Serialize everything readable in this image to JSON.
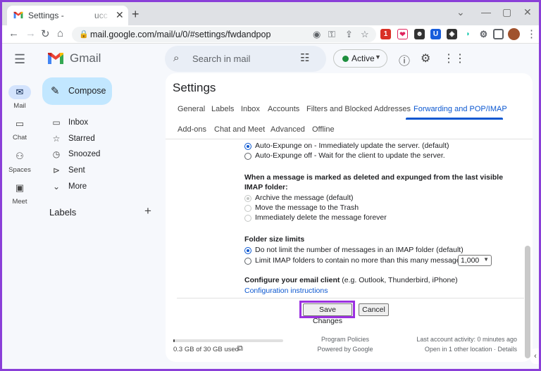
{
  "browser": {
    "tab_title": "Settings - ",
    "tab_title_tail": "ucc",
    "url": "mail.google.com/mail/u/0/#settings/fwdandpop",
    "extension_badge": "1"
  },
  "gmail": {
    "product": "Gmail",
    "search_placeholder": "Search in mail",
    "status": "Active",
    "status_color": "#1e8e3e",
    "accent_color": "#0b57d0",
    "compose_color": "#c2e7ff",
    "highlight_color": "#9b30e0"
  },
  "rail": {
    "mail": "Mail",
    "chat": "Chat",
    "spaces": "Spaces",
    "meet": "Meet"
  },
  "sidebar": {
    "compose": "Compose",
    "items": [
      {
        "label": "Inbox",
        "icon": "inbox-icon"
      },
      {
        "label": "Starred",
        "icon": "star-icon"
      },
      {
        "label": "Snoozed",
        "icon": "clock-icon"
      },
      {
        "label": "Sent",
        "icon": "send-icon"
      },
      {
        "label": "More",
        "icon": "chevron-down-icon"
      }
    ],
    "labels_heading": "Labels"
  },
  "settings": {
    "title": "Settings",
    "tabs": [
      "General",
      "Labels",
      "Inbox",
      "Accounts",
      "Filters and Blocked Addresses",
      "Forwarding and POP/IMAP",
      "Add-ons",
      "Chat and Meet",
      "Advanced",
      "Offline"
    ],
    "active_tab": "Forwarding and POP/IMAP",
    "expunge": {
      "on": "Auto-Expunge on - Immediately update the server. (default)",
      "off": "Auto-Expunge off - Wait for the client to update the server.",
      "selected": "on"
    },
    "deleted": {
      "title_line1": "When a message is marked as deleted and expunged from the last visible",
      "title_line2": "IMAP folder:",
      "options": [
        "Archive the message (default)",
        "Move the message to the Trash",
        "Immediately delete the message forever"
      ]
    },
    "folder_size": {
      "title": "Folder size limits",
      "unlimited": "Do not limit the number of messages in an IMAP folder (default)",
      "limited": "Limit IMAP folders to contain no more than this many messages",
      "limit_value": "1,000"
    },
    "client": {
      "title": "Configure your email client",
      "note": " (e.g. Outlook, Thunderbird, iPhone)",
      "link": "Configuration instructions"
    },
    "save_label": "Save Changes",
    "cancel_label": "Cancel"
  },
  "footer": {
    "storage": "0.3 GB of 30 GB used",
    "storage_fraction": 0.01,
    "program_policies": "Program Policies",
    "powered_by": "Powered by Google",
    "last_activity": "Last account activity: 0 minutes ago",
    "other_location": "Open in 1 other location · Details"
  }
}
